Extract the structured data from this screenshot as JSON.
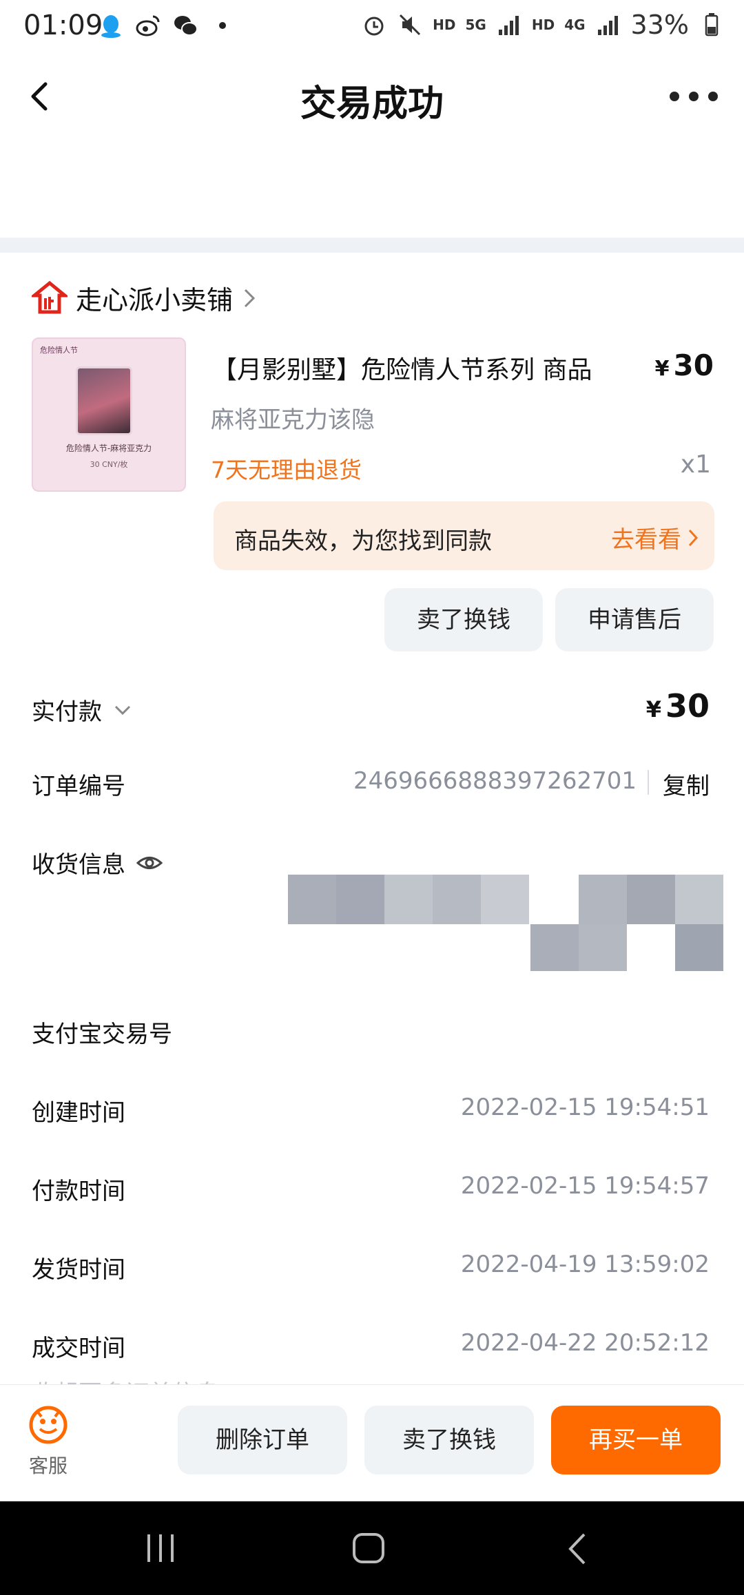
{
  "status_bar": {
    "time": "01:09",
    "network_left": "HD",
    "network_5g": "5G",
    "network_right": "HD",
    "network_4g": "4G",
    "battery": "33%"
  },
  "header": {
    "title": "交易成功"
  },
  "shop": {
    "name": "走心派小卖铺"
  },
  "product": {
    "title": "【月影别墅】危险情人节系列 商品",
    "price": "30",
    "currency": "¥",
    "spec": "麻将亚克力该隐",
    "return_policy": "7天无理由退货",
    "quantity": "x1",
    "thumb_logo": "危险情人节",
    "thumb_text": "危险情人节-麻将亚克力",
    "thumb_sub": "30 CNY/枚"
  },
  "similar": {
    "text": "商品失效，为您找到同款",
    "link": "去看看"
  },
  "actions": {
    "sell": "卖了换钱",
    "after_sale": "申请售后"
  },
  "info": {
    "paid_label": "实付款",
    "paid_amount": "30",
    "order_no_label": "订单编号",
    "order_no": "2469666888397262701",
    "copy": "复制",
    "shipping_label": "收货信息",
    "alipay_label": "支付宝交易号",
    "created_label": "创建时间",
    "created": "2022-02-15 19:54:51",
    "paid_time_label": "付款时间",
    "paid_time": "2022-02-15 19:54:57",
    "shipped_label": "发货时间",
    "shipped": "2022-04-19 13:59:02",
    "closed_label": "成交时间",
    "closed": "2022-04-22 20:52:12",
    "collapse": "收起更多订单信息"
  },
  "bottom": {
    "cs_label": "客服",
    "delete": "删除订单",
    "sell": "卖了换钱",
    "rebuy": "再买一单"
  },
  "colors": {
    "accent_orange": "#ff6a00",
    "policy_orange": "#f0741e",
    "banner_bg": "#fdeee4",
    "button_gray": "#f0f3f6"
  }
}
